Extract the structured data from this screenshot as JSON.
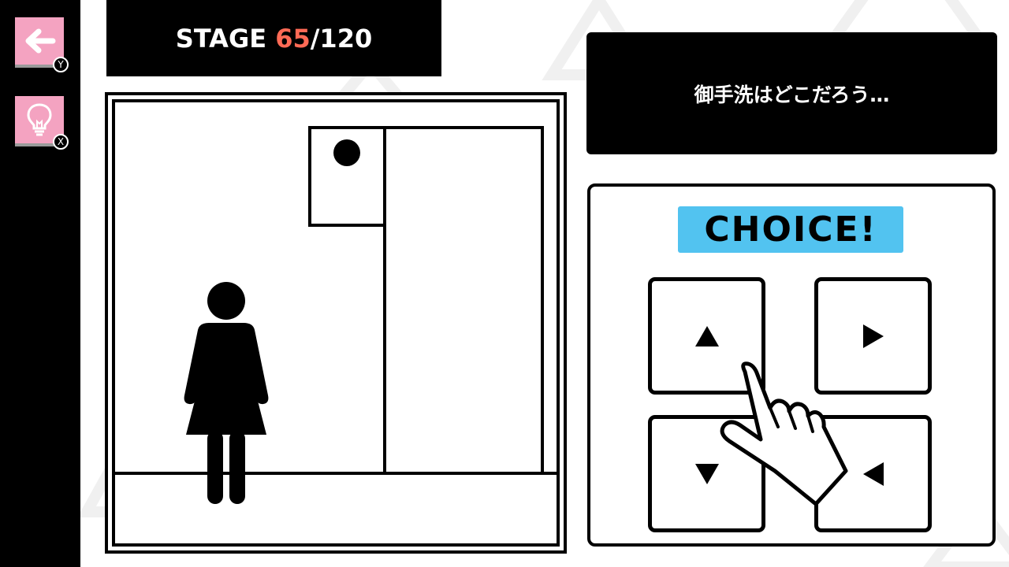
{
  "sidebar": {
    "back": {
      "icon": "back-arrow-icon",
      "key": "Y"
    },
    "hint": {
      "icon": "lightbulb-icon",
      "key": "X"
    },
    "button_color": "#f4a3c1"
  },
  "stage": {
    "prefix": "STAGE ",
    "current": "65",
    "separator_total": "/120",
    "current_color": "#ff6a55"
  },
  "message": "御手洗はどこだろう…",
  "scene": {
    "figure": "woman-restroom-pictogram-icon",
    "wall_sign": "circle-sign-icon"
  },
  "choice": {
    "title": "CHOICE!",
    "title_bg": "#52c3f0",
    "buttons": [
      {
        "direction": "up",
        "icon": "triangle-up-icon"
      },
      {
        "direction": "right",
        "icon": "triangle-right-icon"
      },
      {
        "direction": "down",
        "icon": "triangle-down-icon"
      },
      {
        "direction": "left",
        "icon": "triangle-left-icon"
      }
    ],
    "pointer": "pointing-hand-icon"
  }
}
